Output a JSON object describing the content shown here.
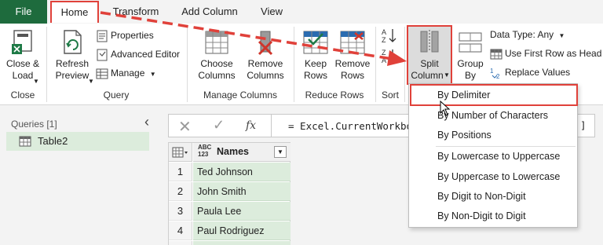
{
  "tabs": {
    "file": "File",
    "home": "Home",
    "transform": "Transform",
    "add_column": "Add Column",
    "view": "View"
  },
  "ribbon": {
    "close": {
      "btn1": "Close &",
      "btn2": "Load",
      "group": "Close"
    },
    "query": {
      "refresh1": "Refresh",
      "refresh2": "Preview",
      "properties": "Properties",
      "advanced_editor": "Advanced Editor",
      "manage": "Manage",
      "group": "Query"
    },
    "manage_columns": {
      "choose1": "Choose",
      "choose2": "Columns",
      "remove1": "Remove",
      "remove2": "Columns",
      "group": "Manage Columns"
    },
    "reduce_rows": {
      "keep1": "Keep",
      "keep2": "Rows",
      "remove1": "Remove",
      "remove2": "Rows",
      "group": "Reduce Rows"
    },
    "sort": {
      "group": "Sort"
    },
    "transform": {
      "split1": "Split",
      "split2": "Column",
      "group1": "Group",
      "group2": "By",
      "data_type": "Data Type: Any",
      "first_row": "Use First Row as Head",
      "replace": "Replace Values"
    }
  },
  "queries": {
    "title": "Queries [1]",
    "item": "Table2"
  },
  "formula": {
    "text": "= Excel.CurrentWorkbo",
    "tail": "]",
    "cancel_icon": "x-icon",
    "commit_icon": "check-icon",
    "fx": "fx"
  },
  "table": {
    "type_badge_top": "ABC",
    "type_badge_bottom": "123",
    "header": "Names",
    "rows": [
      {
        "n": "1",
        "name": "Ted Johnson"
      },
      {
        "n": "2",
        "name": "John Smith"
      },
      {
        "n": "3",
        "name": "Paula Lee"
      },
      {
        "n": "4",
        "name": "Paul Rodriguez"
      }
    ]
  },
  "dropdown": {
    "items": [
      "By Delimiter",
      "By Number of Characters",
      "By Positions",
      "By Lowercase to Uppercase",
      "By Uppercase to Lowercase",
      "By Digit to Non-Digit",
      "By Non-Digit to Digit"
    ]
  },
  "colors": {
    "accent_green": "#1e6b3d",
    "highlight_red": "#e0413a",
    "selection_green": "#dcecdc"
  }
}
